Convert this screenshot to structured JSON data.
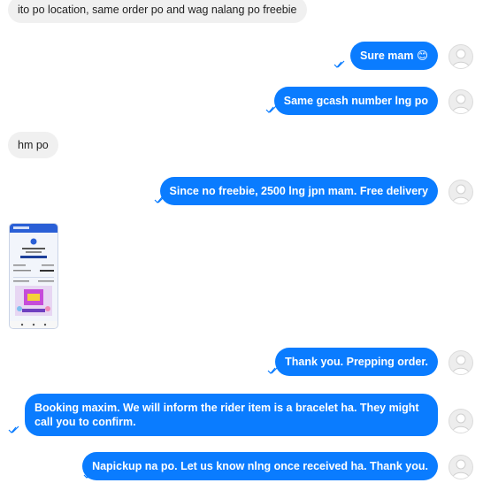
{
  "messages": [
    {
      "id": "m1",
      "dir": "in",
      "text": "ito po location, same order po and wag nalang po freebie"
    },
    {
      "id": "m2",
      "dir": "out",
      "text": "Sure mam 😊"
    },
    {
      "id": "m3",
      "dir": "out",
      "text": "Same gcash number lng po"
    },
    {
      "id": "m4",
      "dir": "in",
      "text": "hm po"
    },
    {
      "id": "m5",
      "dir": "out",
      "text": "Since no freebie, 2500 lng jpn mam. Free delivery"
    },
    {
      "id": "m6",
      "dir": "in",
      "type": "image",
      "icon": "receipt-screenshot-thumbnail"
    },
    {
      "id": "m7",
      "dir": "out",
      "text": "Thank you. Prepping order."
    },
    {
      "id": "m8",
      "dir": "out",
      "text": "Booking maxim. We will inform the rider item is a bracelet ha. They might call you to confirm."
    },
    {
      "id": "m9",
      "dir": "out",
      "text": "Napickup na po. Let us know nlng once received ha. Thank you."
    }
  ],
  "colors": {
    "outgoing": "#0a7cff",
    "incoming": "#f0f0f0",
    "check": "#0a7cff"
  }
}
